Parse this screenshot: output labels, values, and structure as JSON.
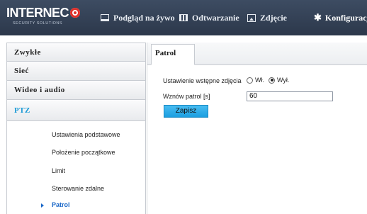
{
  "brand": {
    "logo_text": "INTERNEC",
    "logo_sub": "SECURITY SOLUTIONS",
    "accent": "#e0312b"
  },
  "nav": [
    {
      "label": "Podgląd na żywo",
      "icon": "monitor-icon"
    },
    {
      "label": "Odtwarzanie",
      "icon": "film-icon"
    },
    {
      "label": "Zdjęcie",
      "icon": "picture-icon"
    },
    {
      "label": "Konfiguracja",
      "icon": "gear-icon",
      "active": true
    }
  ],
  "sidebar": {
    "items": [
      "Zwykłe",
      "Sieć",
      "Wideo i audio",
      "PTZ"
    ],
    "active": "PTZ",
    "submenu": [
      "Ustawienia podstawowe",
      "Położenie początkowe",
      "Limit",
      "Sterowanie zdalne",
      "Patrol"
    ],
    "submenu_active": "Patrol"
  },
  "tab": {
    "label": "Patrol"
  },
  "form": {
    "preset_label": "Ustawienie wstępne zdjęcia",
    "option_on": "Wł.",
    "option_off": "Wył.",
    "selected": "Wył.",
    "resume_label": "Wznów patrol [s]",
    "resume_value": "60",
    "save_label": "Zapisz"
  },
  "colors": {
    "topbar": "#2c384b",
    "link_blue": "#1a67c8",
    "ptz_blue": "#1a9ad6",
    "button": "#1b9ee0"
  }
}
